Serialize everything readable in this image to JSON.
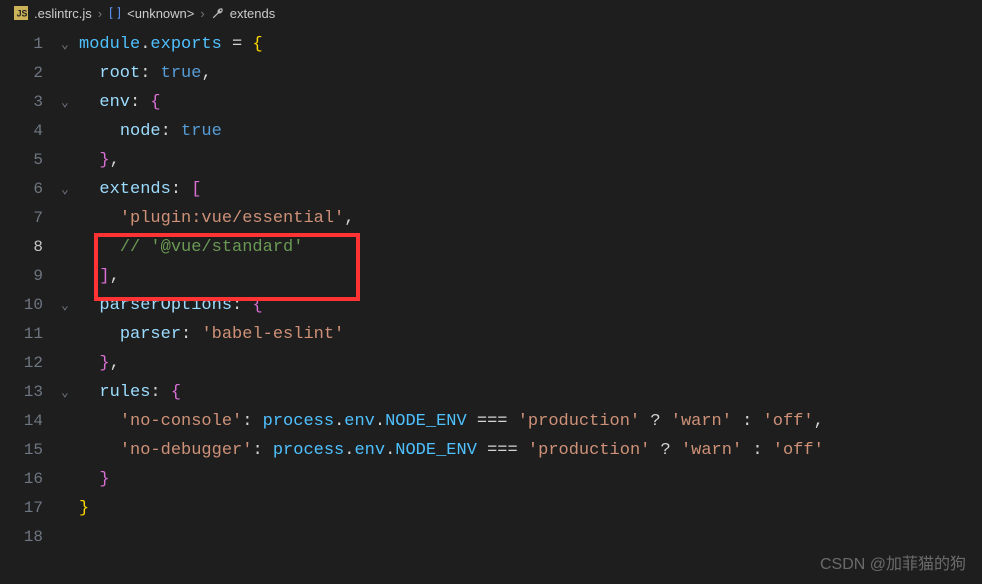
{
  "breadcrumb": {
    "file": ".eslintrc.js",
    "sym1": "<unknown>",
    "sym2": "extends"
  },
  "code": {
    "l1": {
      "a": "module",
      "b": ".",
      "c": "exports",
      "d": " = ",
      "e": "{"
    },
    "l2": {
      "a": "root",
      "b": ": ",
      "c": "true",
      "d": ","
    },
    "l3": {
      "a": "env",
      "b": ": ",
      "c": "{"
    },
    "l4": {
      "a": "node",
      "b": ": ",
      "c": "true"
    },
    "l5": {
      "a": "}",
      "b": ","
    },
    "l6": {
      "a": "extends",
      "b": ": ",
      "c": "["
    },
    "l7": {
      "a": "'plugin:vue/essential'",
      "b": ","
    },
    "l8": {
      "a": "// '@vue/standard'"
    },
    "l9": {
      "a": "]",
      "b": ","
    },
    "l10": {
      "a": "parserOptions",
      "b": ": ",
      "c": "{"
    },
    "l11": {
      "a": "parser",
      "b": ": ",
      "c": "'babel-eslint'"
    },
    "l12": {
      "a": "}",
      "b": ","
    },
    "l13": {
      "a": "rules",
      "b": ": ",
      "c": "{"
    },
    "l14": {
      "a": "'no-console'",
      "b": ": ",
      "c": "process",
      "d": ".",
      "e": "env",
      "f": ".",
      "g": "NODE_ENV",
      "h": " === ",
      "i": "'production'",
      "j": " ? ",
      "k": "'warn'",
      "l": " : ",
      "m": "'off'",
      "n": ","
    },
    "l15": {
      "a": "'no-debugger'",
      "b": ": ",
      "c": "process",
      "d": ".",
      "e": "env",
      "f": ".",
      "g": "NODE_ENV",
      "h": " === ",
      "i": "'production'",
      "j": " ? ",
      "k": "'warn'",
      "l": " : ",
      "m": "'off'"
    },
    "l16": {
      "a": "}"
    },
    "l17": {
      "a": "}"
    }
  },
  "lines": [
    "1",
    "2",
    "3",
    "4",
    "5",
    "6",
    "7",
    "8",
    "9",
    "10",
    "11",
    "12",
    "13",
    "14",
    "15",
    "16",
    "17",
    "18"
  ],
  "watermark": "CSDN @加菲猫的狗"
}
